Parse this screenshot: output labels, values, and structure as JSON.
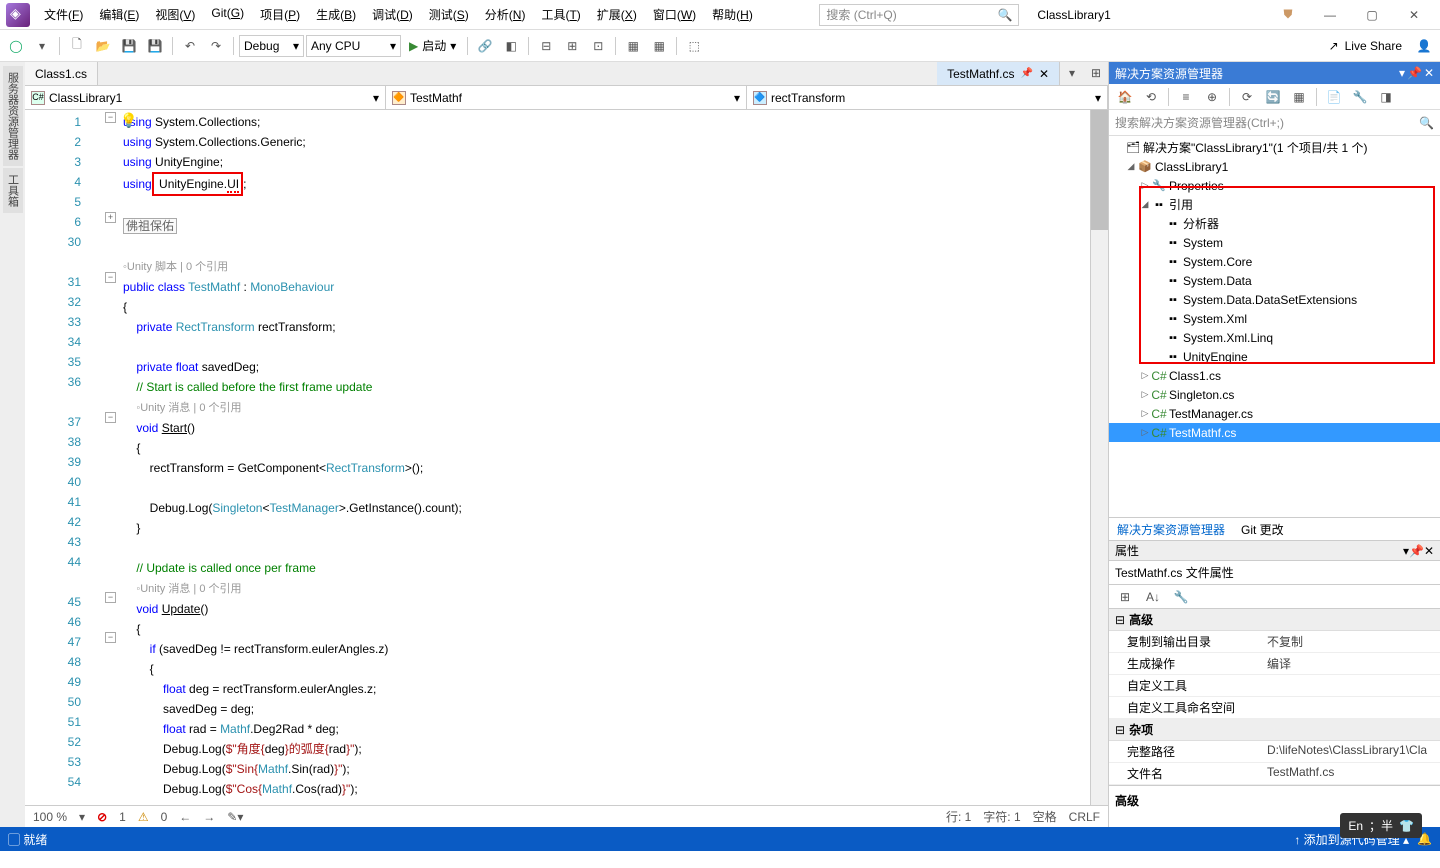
{
  "title": {
    "menus": [
      {
        "l": "文件",
        "u": "F"
      },
      {
        "l": "编辑",
        "u": "E"
      },
      {
        "l": "视图",
        "u": "V"
      },
      {
        "l": "Git",
        "u": "G"
      },
      {
        "l": "项目",
        "u": "P"
      },
      {
        "l": "生成",
        "u": "B"
      },
      {
        "l": "调试",
        "u": "D"
      },
      {
        "l": "测试",
        "u": "S"
      },
      {
        "l": "分析",
        "u": "N"
      },
      {
        "l": "工具",
        "u": "T"
      },
      {
        "l": "扩展",
        "u": "X"
      },
      {
        "l": "窗口",
        "u": "W"
      },
      {
        "l": "帮助",
        "u": "H"
      }
    ],
    "search_ph": "搜索 (Ctrl+Q)",
    "solution": "ClassLibrary1"
  },
  "toolbar": {
    "config": "Debug",
    "platform": "Any CPU",
    "start": "启动",
    "live_share": "Live Share"
  },
  "left_tabs": [
    "服务器资源管理器",
    "工具箱"
  ],
  "doc_tabs": {
    "active": "Class1.cs",
    "pinned": "TestMathf.cs"
  },
  "nav": {
    "a": "ClassLibrary1",
    "b": "TestMathf",
    "c": "rectTransform"
  },
  "gutter": [
    "1",
    "2",
    "3",
    "4",
    "5",
    "6",
    "30",
    "",
    "31",
    "32",
    "33",
    "34",
    "35",
    "36",
    "",
    "37",
    "38",
    "39",
    "40",
    "41",
    "42",
    "43",
    "44",
    "",
    "45",
    "46",
    "47",
    "48",
    "49",
    "50",
    "51",
    "52",
    "53",
    "54"
  ],
  "code": [
    [
      [
        "kw",
        "using"
      ],
      [
        "",
        " System.Collections;"
      ]
    ],
    [
      [
        "kw",
        "using"
      ],
      [
        "",
        " System.Collections.Generic;"
      ]
    ],
    [
      [
        "kw",
        "using"
      ],
      [
        "",
        " UnityEngine;"
      ]
    ],
    [
      [
        "kw",
        "using"
      ],
      [
        "redbox",
        " UnityEngine."
      ],
      [
        "err",
        "UI"
      ],
      [
        "",
        ";"
      ]
    ],
    [],
    [
      [
        "greytag",
        "佛祖保佑"
      ]
    ],
    [],
    [
      [
        "lens",
        "◦Unity 脚本 | 0 个引用"
      ]
    ],
    [
      [
        "kw",
        "public class"
      ],
      [
        "",
        " "
      ],
      [
        "type",
        "TestMathf"
      ],
      [
        "",
        " : "
      ],
      [
        "type",
        "MonoBehaviour"
      ]
    ],
    [
      [
        "",
        "{"
      ]
    ],
    [
      [
        "",
        "    "
      ],
      [
        "kw",
        "private"
      ],
      [
        "",
        " "
      ],
      [
        "type",
        "RectTransform"
      ],
      [
        "",
        " rectTransform;"
      ]
    ],
    [],
    [
      [
        "",
        "    "
      ],
      [
        "kw",
        "private float"
      ],
      [
        "",
        " savedDeg;"
      ]
    ],
    [
      [
        "",
        "    "
      ],
      [
        "com",
        "// Start is called before the first frame update"
      ]
    ],
    [
      [
        "",
        "    "
      ],
      [
        "lens",
        "◦Unity 消息 | 0 个引用"
      ]
    ],
    [
      [
        "",
        "    "
      ],
      [
        "kw",
        "void"
      ],
      [
        "",
        " "
      ],
      [
        "u",
        "Start"
      ],
      [
        "",
        "()"
      ]
    ],
    [
      [
        "",
        "    {"
      ]
    ],
    [
      [
        "",
        "        rectTransform = GetComponent<"
      ],
      [
        "type",
        "RectTransform"
      ],
      [
        "",
        ">();"
      ]
    ],
    [],
    [
      [
        "",
        "        Debug.Log("
      ],
      [
        "type",
        "Singleton"
      ],
      [
        "",
        "<"
      ],
      [
        "type",
        "TestManager"
      ],
      [
        "",
        ">.GetInstance().count);"
      ]
    ],
    [
      [
        "",
        "    }"
      ]
    ],
    [],
    [
      [
        "",
        "    "
      ],
      [
        "com",
        "// Update is called once per frame"
      ]
    ],
    [
      [
        "",
        "    "
      ],
      [
        "lens",
        "◦Unity 消息 | 0 个引用"
      ]
    ],
    [
      [
        "",
        "    "
      ],
      [
        "kw",
        "void"
      ],
      [
        "",
        " "
      ],
      [
        "u",
        "Update"
      ],
      [
        "",
        "()"
      ]
    ],
    [
      [
        "",
        "    {"
      ]
    ],
    [
      [
        "",
        "        "
      ],
      [
        "kw",
        "if"
      ],
      [
        "",
        " (savedDeg != rectTransform.eulerAngles.z)"
      ]
    ],
    [
      [
        "",
        "        {"
      ]
    ],
    [
      [
        "",
        "            "
      ],
      [
        "kw",
        "float"
      ],
      [
        "",
        " deg = rectTransform.eulerAngles.z;"
      ]
    ],
    [
      [
        "",
        "            savedDeg = deg;"
      ]
    ],
    [
      [
        "",
        "            "
      ],
      [
        "kw",
        "float"
      ],
      [
        "",
        " rad = "
      ],
      [
        "type",
        "Mathf"
      ],
      [
        "",
        ".Deg2Rad * deg;"
      ]
    ],
    [
      [
        "",
        "            Debug.Log("
      ],
      [
        "str",
        "$\"角度{"
      ],
      [
        "",
        "deg"
      ],
      [
        "str",
        "}的弧度{"
      ],
      [
        "",
        "rad"
      ],
      [
        "str",
        "}\""
      ],
      [
        "",
        ");"
      ]
    ],
    [
      [
        "",
        "            Debug.Log("
      ],
      [
        "str",
        "$\"Sin{"
      ],
      [
        "type",
        "Mathf"
      ],
      [
        "",
        ".Sin(rad)"
      ],
      [
        "str",
        "}\""
      ],
      [
        "",
        ");"
      ]
    ],
    [
      [
        "",
        "            Debug.Log("
      ],
      [
        "str",
        "$\"Cos{"
      ],
      [
        "type",
        "Mathf"
      ],
      [
        "",
        ".Cos(rad)"
      ],
      [
        "str",
        "}\""
      ],
      [
        "",
        ");"
      ]
    ]
  ],
  "status_strip": {
    "zoom": "100 %",
    "err": "1",
    "warn": "0",
    "ln": "行: 1",
    "col": "字符: 1",
    "spc": "空格",
    "eol": "CRLF"
  },
  "solution_explorer": {
    "title": "解决方案资源管理器",
    "search_ph": "搜索解决方案资源管理器(Ctrl+;)",
    "root": "解决方案\"ClassLibrary1\"(1 个项目/共 1 个)",
    "project": "ClassLibrary1",
    "props": "Properties",
    "refs": "引用",
    "ref_items": [
      "分析器",
      "System",
      "System.Core",
      "System.Data",
      "System.Data.DataSetExtensions",
      "System.Xml",
      "System.Xml.Linq",
      "UnityEngine"
    ],
    "files": [
      "Class1.cs",
      "Singleton.cs",
      "TestManager.cs",
      "TestMathf.cs"
    ],
    "tabs": [
      "解决方案资源管理器",
      "Git 更改"
    ]
  },
  "properties": {
    "title": "属性",
    "subject": "TestMathf.cs 文件属性",
    "cat1": "高级",
    "rows1": [
      [
        "复制到输出目录",
        "不复制"
      ],
      [
        "生成操作",
        "编译"
      ],
      [
        "自定义工具",
        ""
      ],
      [
        "自定义工具命名空间",
        ""
      ]
    ],
    "cat2": "杂项",
    "rows2": [
      [
        "完整路径",
        "D:\\lifeNotes\\ClassLibrary1\\Cla"
      ],
      [
        "文件名",
        "TestMathf.cs"
      ]
    ],
    "desc": "高级"
  },
  "statusbar": {
    "ready": "就绪",
    "scm": "添加到源代码管理"
  },
  "ime": {
    "lang": "En",
    "mode": "；半",
    "ic": "👕"
  }
}
